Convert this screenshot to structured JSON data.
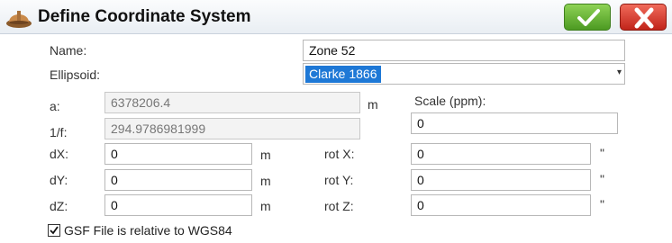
{
  "window": {
    "title": "Define Coordinate System"
  },
  "icons": {
    "app": "hard-hat-icon",
    "ok": "checkmark-icon",
    "close": "x-close-icon"
  },
  "colors": {
    "ok": "#5cae2e",
    "close": "#d9362a",
    "selection": "#1e78d6"
  },
  "form": {
    "name_label": "Name:",
    "name_value": "Zone 52",
    "ellipsoid_label": "Ellipsoid:",
    "ellipsoid_value": "Clarke 1866",
    "a_label": "a:",
    "a_value": "6378206.4",
    "a_unit": "m",
    "f_label": "1/f:",
    "f_value": "294.9786981999",
    "scale_label": "Scale (ppm):",
    "scale_value": "0",
    "dx_label": "dX:",
    "dx_value": "0",
    "dx_unit": "m",
    "dy_label": "dY:",
    "dy_value": "0",
    "dy_unit": "m",
    "dz_label": "dZ:",
    "dz_value": "0",
    "dz_unit": "m",
    "rotx_label": "rot X:",
    "rotx_value": "0",
    "rotx_unit": "\"",
    "roty_label": "rot Y:",
    "roty_value": "0",
    "roty_unit": "\"",
    "rotz_label": "rot Z:",
    "rotz_value": "0",
    "rotz_unit": "\"",
    "gsf_checkbox_label": "GSF File is relative to WGS84",
    "gsf_checked": true
  }
}
